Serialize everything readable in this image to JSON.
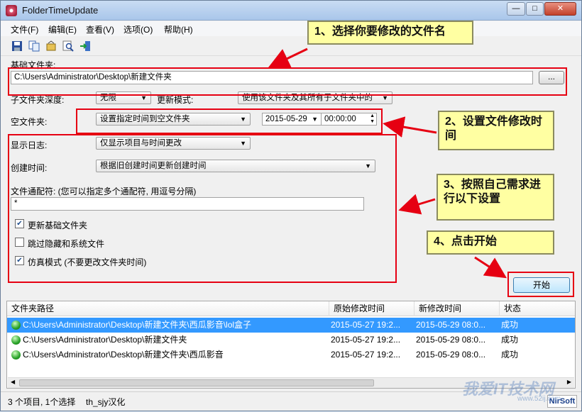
{
  "window": {
    "title": "FolderTimeUpdate",
    "min": "—",
    "max": "□",
    "close": "✕"
  },
  "menu": [
    "文件(F)",
    "编辑(E)",
    "查看(V)",
    "选项(O)",
    "帮助(H)"
  ],
  "form": {
    "base_folder_label": "基础文件夹:",
    "base_folder_value": "C:\\Users\\Administrator\\Desktop\\新建文件夹",
    "browse_label": "...",
    "subfolder_depth_label": "子文件夹深度:",
    "subfolder_depth_value": "无限",
    "update_mode_label": "更新模式:",
    "update_mode_value": "使用该文件夹及其所有子文件夹中的",
    "empty_folder_label": "空文件夹:",
    "empty_folder_value": "设置指定时间到空文件夹",
    "date_value": "2015-05-29",
    "time_value": "00:00:00",
    "show_log_label": "显示日志:",
    "show_log_value": "仅显示项目与时间更改",
    "create_time_label": "创建时间:",
    "create_time_value": "根据旧创建时间更新创建时间",
    "wildcard_label": "文件通配符: (您可以指定多个通配符, 用逗号分隔)",
    "wildcard_value": "*",
    "chk_update_base": "更新基础文件夹",
    "chk_skip_hidden": "跳过隐藏和系统文件",
    "chk_simulate": "仿真模式 (不要更改文件夹时间)",
    "start_label": "开始"
  },
  "callouts": {
    "c1": "1、选择你要修改的文件名",
    "c2": "2、设置文件修改时间",
    "c3": "3、按照自己需求进行以下设置",
    "c4": "4、点击开始"
  },
  "table": {
    "headers": [
      "文件夹路径",
      "原始修改时间",
      "新修改时间",
      "状态"
    ],
    "rows": [
      {
        "path": "C:\\Users\\Administrator\\Desktop\\新建文件夹\\西瓜影音\\lol盒子",
        "orig": "2015-05-27 19:2...",
        "new": "2015-05-29 08:0...",
        "status": "成功"
      },
      {
        "path": "C:\\Users\\Administrator\\Desktop\\新建文件夹",
        "orig": "2015-05-27 19:2...",
        "new": "2015-05-29 08:0...",
        "status": "成功"
      },
      {
        "path": "C:\\Users\\Administrator\\Desktop\\新建文件夹\\西瓜影音",
        "orig": "2015-05-27 19:2...",
        "new": "2015-05-29 08:0...",
        "status": "成功"
      }
    ]
  },
  "status": {
    "count": "3 个项目, 1个选择",
    "credit": "th_sjy汉化",
    "nirsoft": "NirSoft"
  },
  "watermark": {
    "main": "我爱IT技术网",
    "sub": "www.52ij.com"
  }
}
